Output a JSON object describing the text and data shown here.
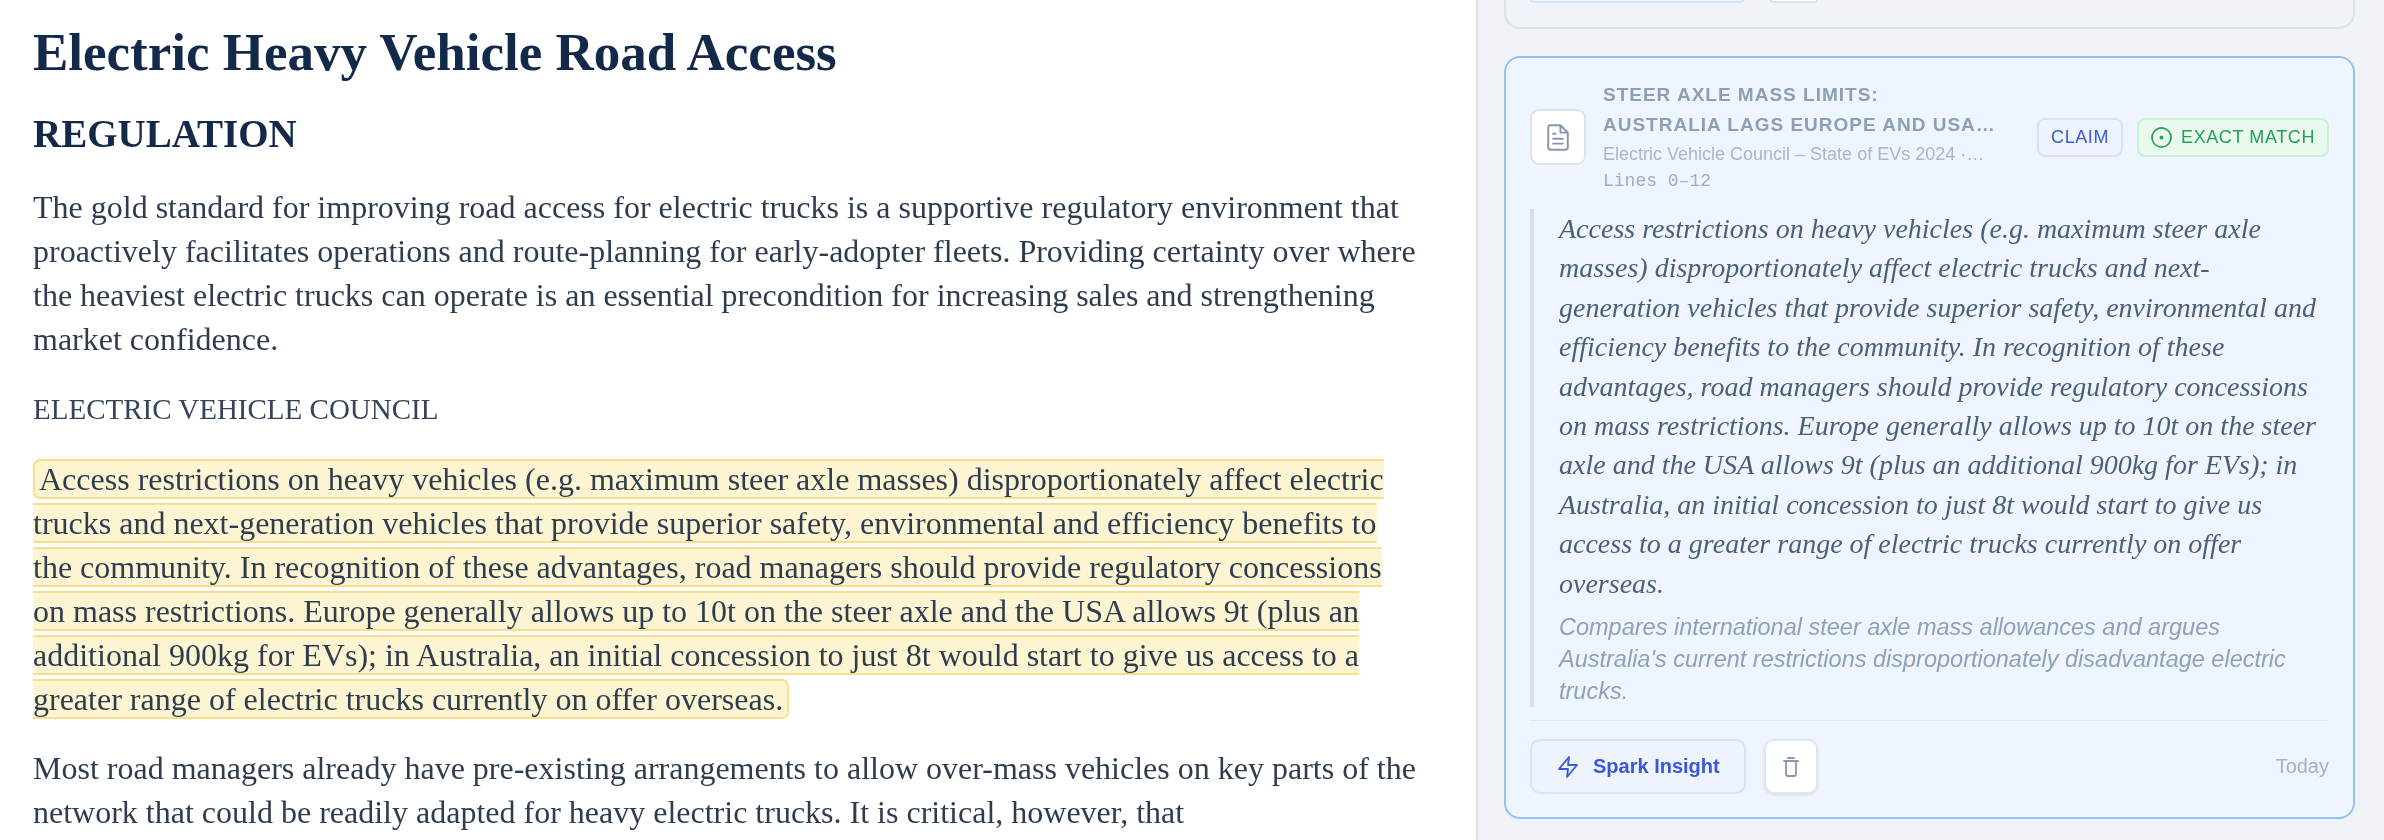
{
  "document": {
    "title": "Electric Heavy Vehicle Road Access",
    "blocks": [
      {
        "kind": "heading",
        "text": "REGULATION"
      },
      {
        "kind": "paragraph",
        "highlighted": false,
        "text": "The gold standard for improving road access for electric trucks is a supportive regulatory environment that proactively facilitates operations and route-planning for early-adopter fleets. Providing certainty over where the heaviest electric trucks can operate is an essential precondition for increasing sales and strengthening market confidence."
      },
      {
        "kind": "byline",
        "text": "ELECTRIC VEHICLE COUNCIL"
      },
      {
        "kind": "paragraph",
        "highlighted": true,
        "text": "Access restrictions on heavy vehicles (e.g. maximum steer axle masses) disproportionately affect electric trucks and next-generation vehicles that provide superior safety, environmental and efficiency benefits to the community. In recognition of these advantages, road managers should provide regulatory concessions on mass restrictions. Europe generally allows up to 10t on the steer axle and the USA allows 9t (plus an additional 900kg for EVs); in Australia, an initial concession to just 8t would start to give us access to a greater range of electric trucks currently on offer overseas."
      },
      {
        "kind": "paragraph",
        "highlighted": false,
        "text": "Most road managers already have pre-existing arrangements to allow over-mass vehicles on key parts of the network that could be readily adapted for heavy electric trucks. It is critical, however, that"
      }
    ]
  },
  "panel": {
    "cards": [
      {
        "kind": "cut-off",
        "selected": false
      },
      {
        "kind": "full",
        "selected": true,
        "title": "STEER AXLE MASS LIMITS: AUSTRALIA LAGS EUROPE AND USA…",
        "source": "Electric Vehicle Council – State of EVs 2024 ·…",
        "lines": "Lines 0–12",
        "badges": [
          {
            "kind": "type",
            "text": "CLAIM"
          },
          {
            "kind": "match",
            "text": "EXACT MATCH"
          }
        ],
        "quote": "Access restrictions on heavy vehicles (e.g. maximum steer axle masses) disproportionately affect electric trucks and next-generation vehicles that provide superior safety, environmental and efficiency benefits to the community. In recognition of these advantages, road managers should provide regulatory concessions on mass restrictions. Europe generally allows up to 10t on the steer axle and the USA allows 9t (plus an additional 900kg for EVs); in Australia, an initial concession to just 8t would start to give us access to a greater range of electric trucks currently on offer overseas.",
        "note": "Compares international steer axle mass allowances and argues Australia's current restrictions disproportionately disadvantage electric trucks.",
        "actions": [
          {
            "kind": "spark",
            "label": "Spark Insight"
          },
          {
            "kind": "delete"
          }
        ],
        "date": "Today"
      }
    ]
  }
}
